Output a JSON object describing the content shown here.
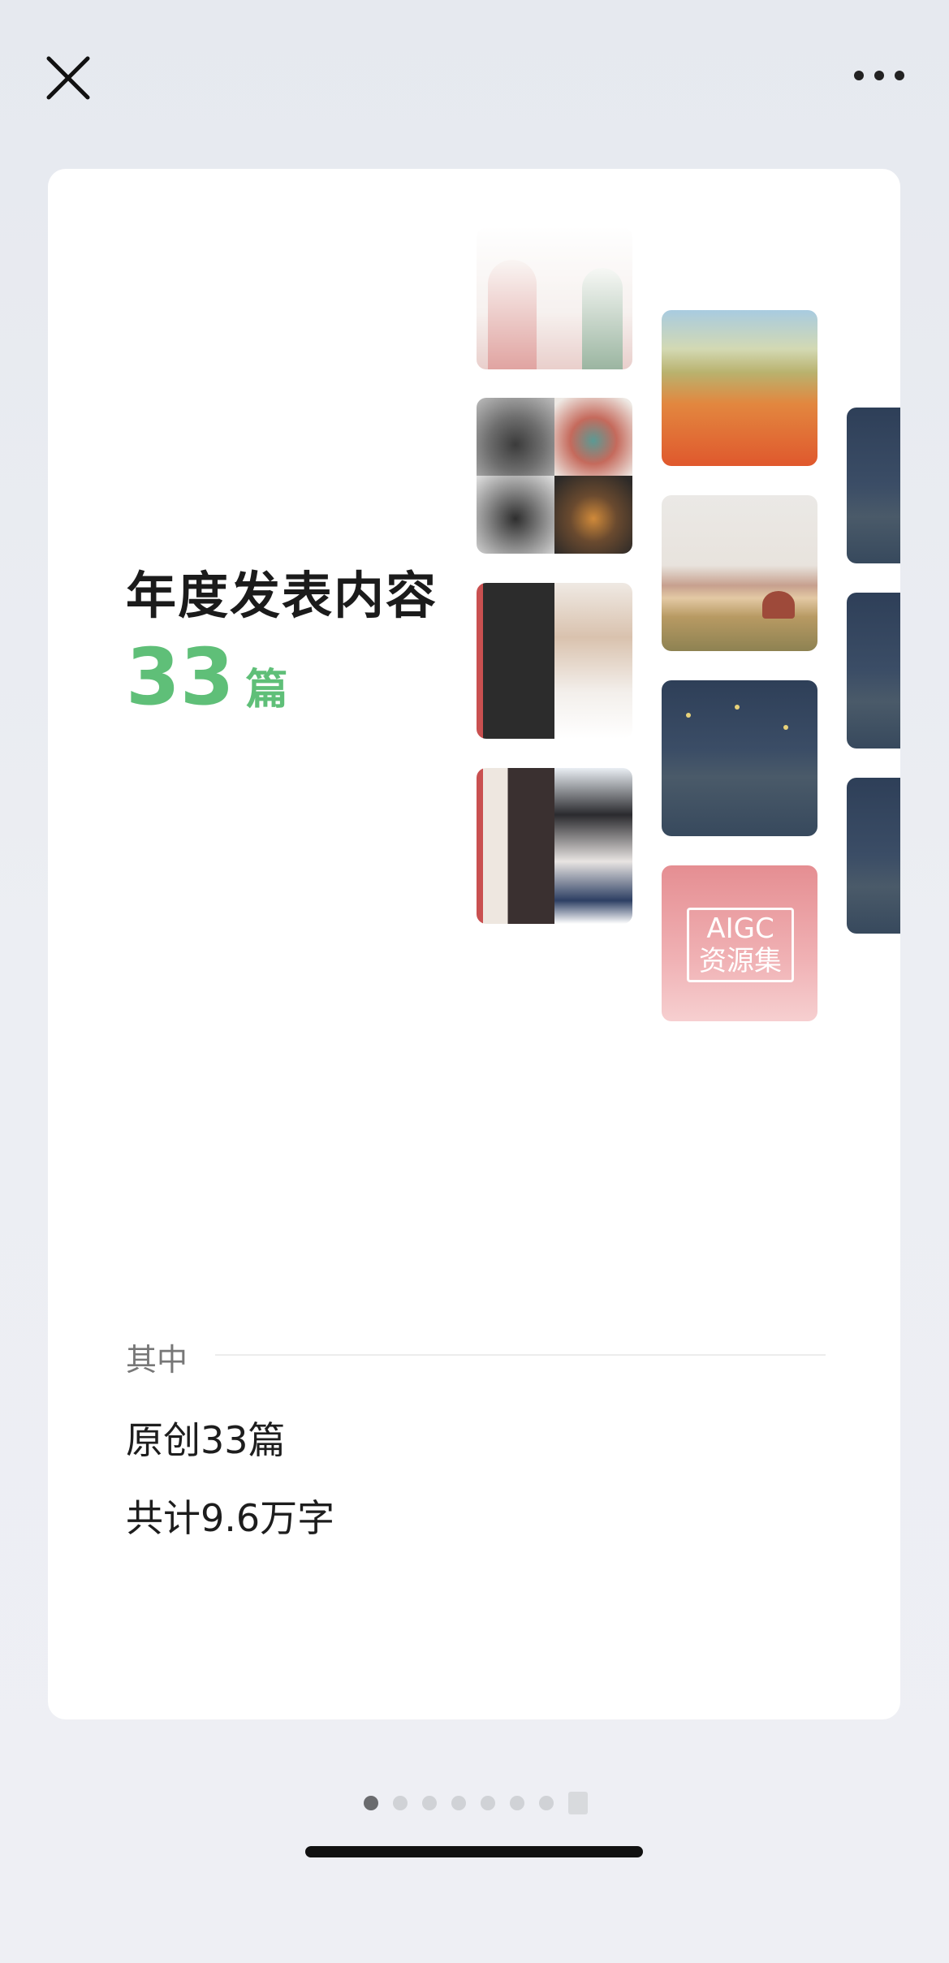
{
  "header": {
    "close_icon": "close-icon",
    "more_icon": "more-icon"
  },
  "card": {
    "title": "年度发表内容",
    "count": "33",
    "count_unit": "篇",
    "accent_color": "#5fbf78",
    "thumbnails": [
      {
        "name": "thumb-women-figures"
      },
      {
        "name": "thumb-dragon-sculptures"
      },
      {
        "name": "thumb-sketch-and-photo-girl"
      },
      {
        "name": "thumb-two-girls-anime"
      },
      {
        "name": "thumb-poppy-field"
      },
      {
        "name": "thumb-haystack-painting"
      },
      {
        "name": "thumb-starry-night-rhone"
      },
      {
        "name": "thumb-aigc-cover",
        "text_line1": "AIGC",
        "text_line2": "资源集"
      },
      {
        "name": "thumb-starry-night-partial"
      }
    ],
    "section_label": "其中",
    "stats": [
      "原创33篇",
      "共计9.6万字"
    ]
  },
  "pagination": {
    "total_dots": 7,
    "active_index": 0
  }
}
